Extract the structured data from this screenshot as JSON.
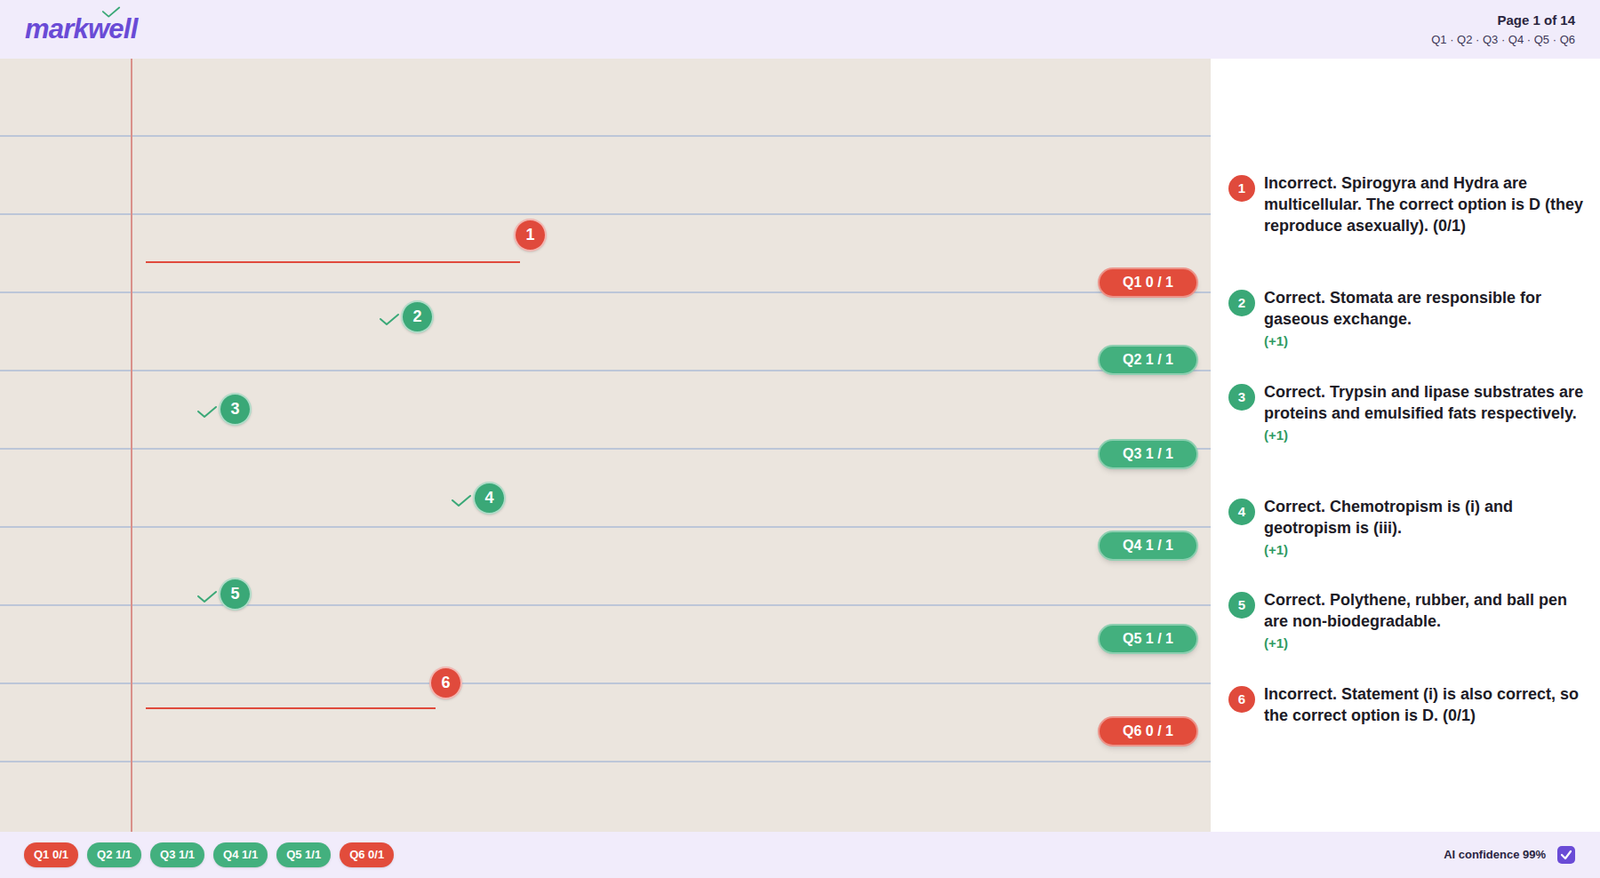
{
  "app": {
    "logo": "markwell"
  },
  "header": {
    "page": "Page 1 of 14",
    "questions": "Q1 · Q2 · Q3 · Q4 · Q5 · Q6"
  },
  "sheet": {
    "kind": "photo"
  },
  "questions": [
    {
      "number": "1",
      "correct": false,
      "score": "Q1 0 / 1",
      "short_score": "Q1 0/1",
      "feedback": "Incorrect. Spirogyra and Hydra are multicellular. The correct option is D (they reproduce asexually). (0/1)"
    },
    {
      "number": "2",
      "correct": true,
      "score": "Q2 1 / 1",
      "short_score": "Q2 1/1",
      "feedback": "Correct. Stomata are responsible for gaseous exchange.",
      "points": "(+1)"
    },
    {
      "number": "3",
      "correct": true,
      "score": "Q3 1 / 1",
      "short_score": "Q3 1/1",
      "feedback": "Correct. Trypsin and lipase substrates are proteins and emulsified fats respectively.",
      "points": "(+1)"
    },
    {
      "number": "4",
      "correct": true,
      "score": "Q4 1 / 1",
      "short_score": "Q4 1/1",
      "feedback": "Correct. Chemotropism is (i) and geotropism is (iii).",
      "points": "(+1)"
    },
    {
      "number": "5",
      "correct": true,
      "score": "Q5 1 / 1",
      "short_score": "Q5 1/1",
      "feedback": "Correct. Polythene, rubber, and ball pen are non-biodegradable.",
      "points": "(+1)"
    },
    {
      "number": "6",
      "correct": false,
      "score": "Q6 0 / 1",
      "short_score": "Q6 0/1",
      "feedback": "Incorrect. Statement (i) is also correct, so the correct option is D. (0/1)"
    }
  ],
  "footer": {
    "confidence": "AI confidence 99%"
  }
}
